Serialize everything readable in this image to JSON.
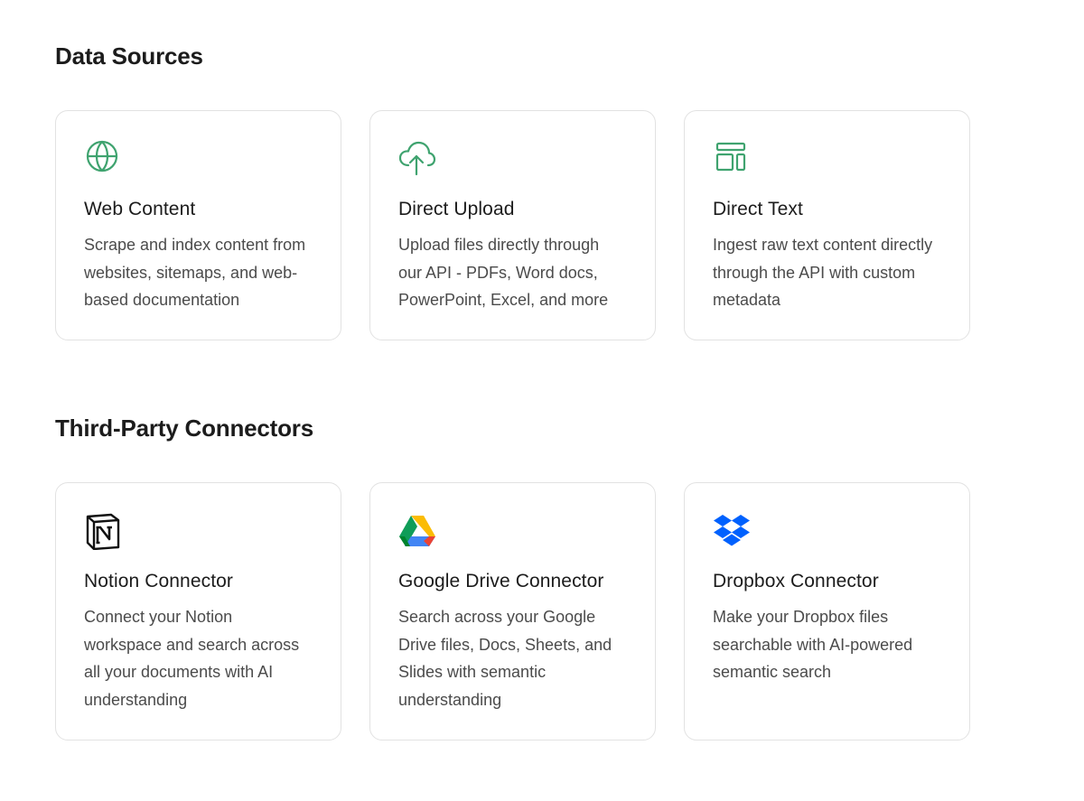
{
  "data_sources": {
    "title": "Data Sources",
    "cards": [
      {
        "icon": "globe-icon",
        "title": "Web Content",
        "description": "Scrape and index content from websites, sitemaps, and web-based documentation"
      },
      {
        "icon": "cloud-upload-icon",
        "title": "Direct Upload",
        "description": "Upload files directly through our API - PDFs, Word docs, PowerPoint, Excel, and more"
      },
      {
        "icon": "layout-icon",
        "title": "Direct Text",
        "description": "Ingest raw text content directly through the API with custom metadata"
      }
    ]
  },
  "connectors": {
    "title": "Third-Party Connectors",
    "cards": [
      {
        "icon": "notion-logo-icon",
        "title": "Notion Connector",
        "description": "Connect your Notion workspace and search across all your documents with AI understanding"
      },
      {
        "icon": "google-drive-logo-icon",
        "title": "Google Drive Connector",
        "description": "Search across your Google Drive files, Docs, Sheets, and Slides with semantic understanding"
      },
      {
        "icon": "dropbox-logo-icon",
        "title": "Dropbox Connector",
        "description": "Make your Dropbox files searchable with AI-powered semantic search"
      }
    ]
  },
  "colors": {
    "accent_green": "#3fa36f",
    "dropbox_blue": "#0061fe",
    "card_border": "#e2e2e2"
  }
}
